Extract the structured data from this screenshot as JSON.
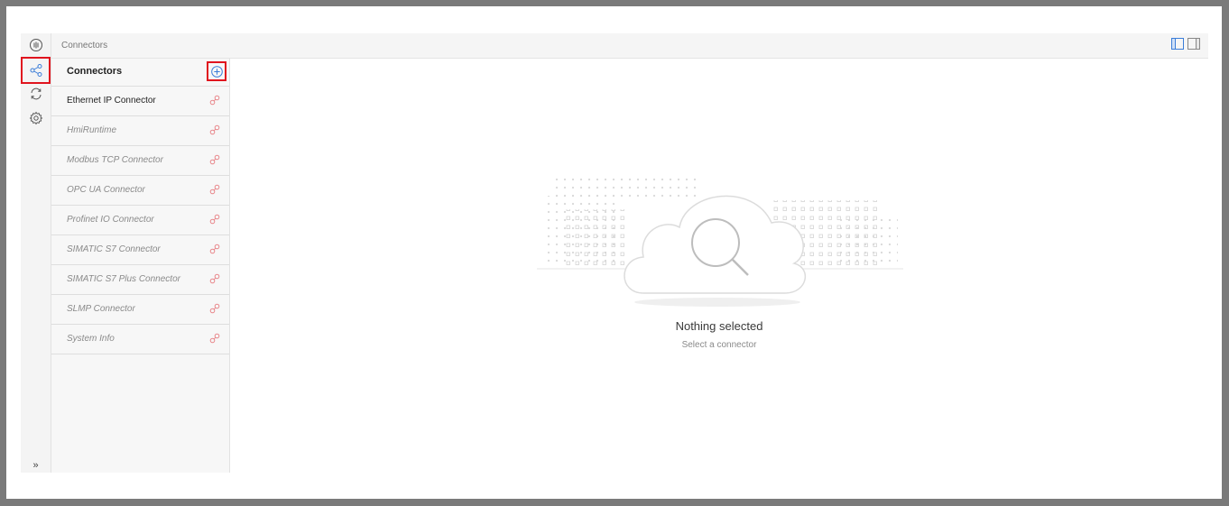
{
  "topbar": {
    "breadcrumb": "Connectors"
  },
  "rail": {
    "items": [
      {
        "icon": "logo-icon"
      },
      {
        "icon": "share-icon",
        "selected": true
      },
      {
        "icon": "sync-icon"
      },
      {
        "icon": "gear-icon"
      }
    ],
    "expand_label": "»"
  },
  "panel": {
    "title": "Connectors",
    "items": [
      {
        "label": "Ethernet IP Connector",
        "active": true
      },
      {
        "label": "HmiRuntime"
      },
      {
        "label": "Modbus TCP Connector"
      },
      {
        "label": "OPC UA Connector"
      },
      {
        "label": "Profinet IO Connector"
      },
      {
        "label": "SIMATIC S7 Connector"
      },
      {
        "label": "SIMATIC S7 Plus Connector"
      },
      {
        "label": "SLMP Connector"
      },
      {
        "label": "System Info"
      }
    ]
  },
  "empty_state": {
    "title": "Nothing selected",
    "subtitle": "Select a connector"
  },
  "colors": {
    "accent": "#3b7dd8",
    "highlight": "#e0141e",
    "link_icon": "#e8868a"
  }
}
